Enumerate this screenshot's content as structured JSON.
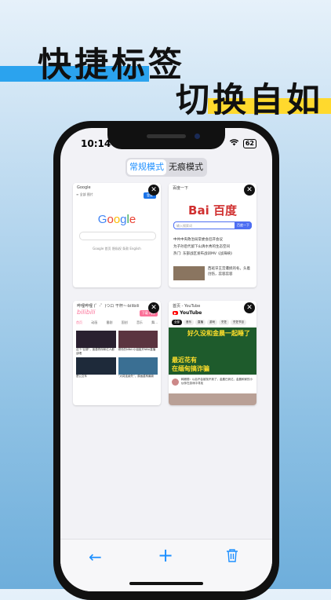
{
  "headline": {
    "line1": "快捷标签",
    "line2": "切换自如"
  },
  "status_bar": {
    "time": "10:14",
    "battery": "62",
    "wifi_icon": "wifi-icon"
  },
  "segments": [
    {
      "label": "常规模式",
      "active": true
    },
    {
      "label": "无痕模式",
      "active": false
    }
  ],
  "tabs": [
    {
      "title": "Google",
      "logo": "Google",
      "btn": "登录",
      "nav": [
        "全部",
        "图片"
      ],
      "links": "Google 首页   隐私权   条款   English",
      "close": "✕"
    },
    {
      "title": "百度一下",
      "logo": "Bai 百度",
      "search_placeholder": "输入搜索词",
      "search_btn": "百度一下",
      "news": [
        "中共中央政治局常委会召开会议",
        "为子孙后代留下山清水秀的生态空间",
        "热门: 东部战区发布战训MV《战海峡》"
      ],
      "text2": "西班牙王宫遭损的冬。头着创伤，蕊容蕊容",
      "close": "✕"
    },
    {
      "title": "哔哩哔哩 (゜-゜)つロ 干杯~-bilibili",
      "logo": "bilibili",
      "download": "下载 App",
      "nav": [
        "首页",
        "动画",
        "番剧",
        "国创",
        "音乐",
        "舞..."
      ],
      "videos": [
        "这个\"巨婴\"，医患同伴和亿人都该喝",
        "燃尽的NBA!小姐姐开NBA直播",
        "是公交车",
        "“大将连续失”，原画重构最新"
      ],
      "close": "✕"
    },
    {
      "title": "首页 - YouTube",
      "logo": "YouTube",
      "chips": [
        "全部",
        "音乐",
        "直播",
        "游戏",
        "烹饪",
        "烹饪节目"
      ],
      "video_text": [
        "好久没和金晨一起睡了",
        "最近花有",
        "在缅甸搞诈骗"
      ],
      "desc": "韩雅丽：以后不会被找不到了，金晨已到达，金晨和家的小伙伴在游戏中寻找",
      "close": "✕"
    }
  ],
  "toolbar": {
    "back": "←",
    "add": "+",
    "delete": "🗑"
  }
}
